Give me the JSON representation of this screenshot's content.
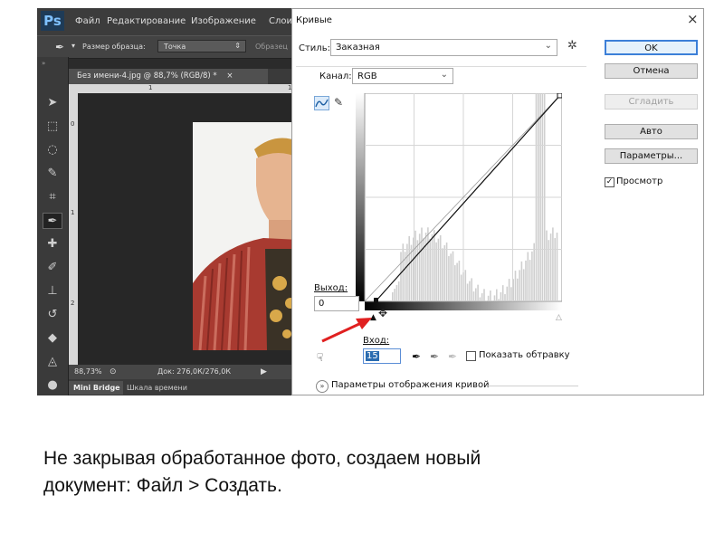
{
  "photoshop": {
    "logo": "Ps",
    "menu": [
      "Файл",
      "Редактирование",
      "Изображение",
      "Слои"
    ],
    "options": {
      "sample_size_label": "Размер образца:",
      "sample_size_value": "Точка",
      "sample_label": "Образец"
    },
    "document_tab": "Без имени-4.jpg @ 88,7% (RGB/8) *",
    "ruler_top_ticks": [
      "1",
      "1"
    ],
    "ruler_left_ticks": [
      "0",
      "1",
      "2"
    ],
    "status": {
      "zoom": "88,73%",
      "doc_info": "Док: 276,0К/276,0К"
    },
    "bottom_tabs": [
      "Mini Bridge",
      "Шкала времени"
    ]
  },
  "curves_dialog": {
    "title": "Кривые",
    "preset_label": "Стиль:",
    "preset_value": "Заказная",
    "channel_label": "Канал:",
    "channel_value": "RGB",
    "buttons": {
      "ok": "OK",
      "cancel": "Отмена",
      "smooth": "Сгладить",
      "auto": "Авто",
      "options": "Параметры..."
    },
    "preview_label": "Просмотр",
    "preview_checked": true,
    "output_label": "Выход:",
    "output_value": "0",
    "input_label": "Вход:",
    "input_value": "15",
    "show_clipping_label": "Показать обтравку",
    "show_clipping_checked": false,
    "curve_display_options_label": "Параметры отображения кривой",
    "accent_color": "#2b6cb0",
    "arrow_color": "#e02020"
  },
  "caption": "Не закрывая обработанное фото, создаем новый\nдокумент: Файл > Создать."
}
